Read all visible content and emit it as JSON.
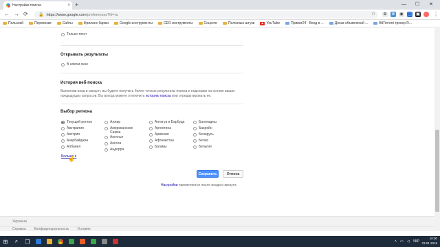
{
  "browser": {
    "tab_title": "Настройки поиска",
    "tab_close": "×",
    "new_tab": "+",
    "win_minimize": "—",
    "win_maximize": "☐",
    "win_close": "✕",
    "url_host": "https://www.google.com",
    "url_path": "/preferences?hl=ru",
    "bookmarks": [
      {
        "label": "Польский",
        "icon": "folder"
      },
      {
        "label": "Перевозки",
        "icon": "folder"
      },
      {
        "label": "Сайты",
        "icon": "folder"
      },
      {
        "label": "Фриланс биржи",
        "icon": "folder"
      },
      {
        "label": "Google инструменты",
        "icon": "folder"
      },
      {
        "label": "СЕО инструменты",
        "icon": "folder"
      },
      {
        "label": "Соцсети",
        "icon": "folder"
      },
      {
        "label": "Полезные штуки",
        "icon": "folder"
      },
      {
        "label": "YouTube",
        "icon": "youtube"
      },
      {
        "label": "Приват24 - Вход в ...",
        "icon": "page"
      },
      {
        "label": "Доска объявлений ...",
        "icon": "page"
      },
      {
        "label": "BitTorrent трекер R...",
        "icon": "page"
      }
    ]
  },
  "page": {
    "text_only": "Только текст",
    "open_results_heading": "Открывать результаты",
    "new_window": "В новом окне",
    "history_heading": "История веб-поиска",
    "history_text_1": "Выполнив вход в аккаунт, вы будете получать более точные результаты поиска и подсказки на основе",
    "history_text_2": "ваших предыдущих запросов. Вы всегда можете отключить",
    "history_link": "историю поиска",
    "history_text_3": "или отредактировать ее.",
    "region_heading": "Выбор региона",
    "regions": [
      [
        "Текущий регион",
        "Австралия",
        "Австрия",
        "Азербайджан",
        "Албания"
      ],
      [
        "Алжир",
        "Американское Самоа",
        "Ангилья",
        "Ангола",
        "Андорра"
      ],
      [
        "Антигуа и Барбуда",
        "Аргентина",
        "Армения",
        "Афганистан",
        "Багамы"
      ],
      [
        "Бангладеш",
        "Бахрейн",
        "Беларусь",
        "Белиз",
        "Бельгия"
      ]
    ],
    "selected_region": "Текущий регион",
    "more_link": "Больше",
    "more_arrow": "▾",
    "save_button": "Сохранить",
    "cancel_button": "Отмена",
    "settings_link": "Настройки",
    "settings_note": "применяются после входа в аккаунт."
  },
  "footer": {
    "country": "Украина",
    "links": [
      "Справка",
      "Конфиденциальность",
      "Условия"
    ]
  },
  "taskbar": {
    "language": "УКР",
    "time": "10:00",
    "date": "23.01.2019"
  }
}
